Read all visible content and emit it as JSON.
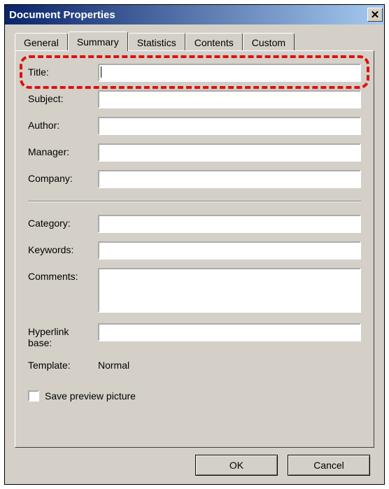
{
  "window": {
    "title": "Document Properties"
  },
  "tabs": {
    "general": "General",
    "summary": "Summary",
    "statistics": "Statistics",
    "contents": "Contents",
    "custom": "Custom",
    "active": "summary"
  },
  "form": {
    "title_label": "Title:",
    "title_value": "",
    "subject_label": "Subject:",
    "subject_value": "",
    "author_label": "Author:",
    "author_value": "",
    "manager_label": "Manager:",
    "manager_value": "",
    "company_label": "Company:",
    "company_value": "",
    "category_label": "Category:",
    "category_value": "",
    "keywords_label": "Keywords:",
    "keywords_value": "",
    "comments_label": "Comments:",
    "comments_value": "",
    "hyperlink_base_label_line1": "Hyperlink",
    "hyperlink_base_label_line2": "base:",
    "hyperlink_base_value": "",
    "template_label": "Template:",
    "template_value": "Normal",
    "save_preview_label": "Save preview picture",
    "save_preview_checked": false
  },
  "buttons": {
    "ok": "OK",
    "cancel": "Cancel"
  },
  "highlight_color": "#d11"
}
